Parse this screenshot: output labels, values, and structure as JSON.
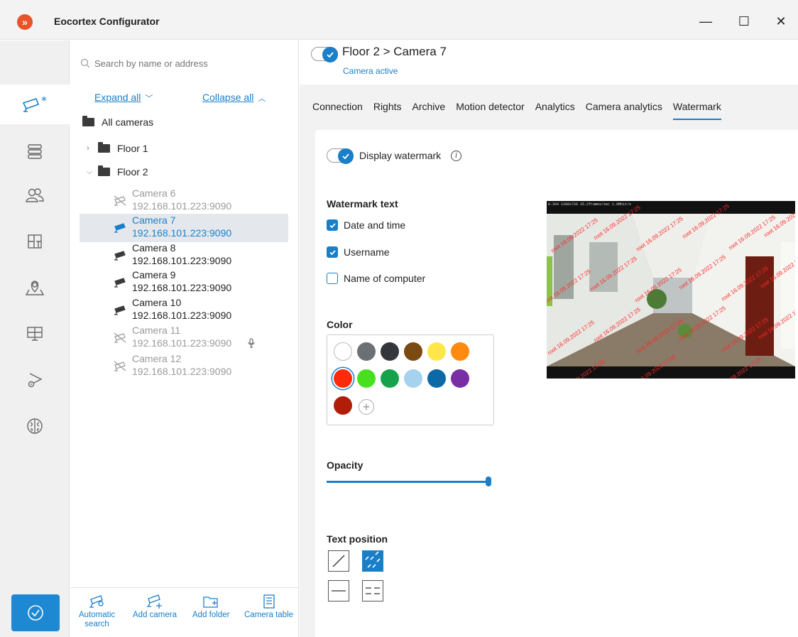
{
  "window": {
    "title": "Eocortex Configurator",
    "logo_glyph": "»",
    "min_glyph": "—",
    "max_glyph": "☐",
    "close_glyph": "✕"
  },
  "rail": {
    "items": [
      {
        "name": "cameras",
        "icon": "camera-icon",
        "active": true
      },
      {
        "name": "servers",
        "icon": "server-icon"
      },
      {
        "name": "users",
        "icon": "users-icon"
      },
      {
        "name": "layouts",
        "icon": "layout-icon"
      },
      {
        "name": "maps",
        "icon": "map-icon"
      },
      {
        "name": "workstations",
        "icon": "monitor-icon"
      },
      {
        "name": "camera-settings",
        "icon": "camera-gear-icon"
      },
      {
        "name": "neural",
        "icon": "brain-icon"
      }
    ]
  },
  "tree": {
    "search_placeholder": "Search by name or address",
    "expand_all": "Expand all",
    "collapse_all": "Collapse all",
    "root": "All cameras",
    "folders": [
      "Floor 1",
      "Floor 2"
    ],
    "cameras": [
      {
        "name": "Camera 6",
        "address": "192.168.101.223:9090",
        "state": "inactive"
      },
      {
        "name": "Camera 7",
        "address": "192.168.101.223:9090",
        "state": "selected"
      },
      {
        "name": "Camera 8",
        "address": "192.168.101.223:9090",
        "state": "active"
      },
      {
        "name": "Camera 9",
        "address": "192.168.101.223:9090",
        "state": "active"
      },
      {
        "name": "Camera 10",
        "address": "192.168.101.223:9090",
        "state": "active"
      },
      {
        "name": "Camera 11",
        "address": "192.168.101.223:9090",
        "state": "inactive"
      },
      {
        "name": "Camera 12",
        "address": "192.168.101.223:9090",
        "state": "inactive"
      }
    ],
    "tools": {
      "automatic_search_1": "Automatic",
      "automatic_search_2": "search",
      "add_camera": "Add camera",
      "add_folder": "Add folder",
      "camera_table": "Camera table"
    }
  },
  "header": {
    "title": "Floor 2 > Camera 7",
    "status": "Camera active"
  },
  "tabs": [
    "Connection",
    "Rights",
    "Archive",
    "Motion detector",
    "Analytics",
    "Camera analytics",
    "Watermark"
  ],
  "active_tab": "Watermark",
  "watermark": {
    "display_label": "Display watermark",
    "display_enabled": true,
    "text_title": "Watermark text",
    "options": [
      {
        "label": "Date and time",
        "checked": true
      },
      {
        "label": "Username",
        "checked": true
      },
      {
        "label": "Name of computer",
        "checked": false
      }
    ],
    "color_title": "Color",
    "colors": [
      "#ffffff",
      "#6b7075",
      "#33363b",
      "#7a4a12",
      "#ffe74a",
      "#ff8a0f",
      "#ff2a0a",
      "#47e01e",
      "#16a24a",
      "#a6d2ee",
      "#0b69a8",
      "#7a2ea6",
      "#b01e0a"
    ],
    "selected_color": "#ff2a0a",
    "opacity_title": "Opacity",
    "opacity": 1.0,
    "position_title": "Text position",
    "positions": [
      "diagonal-single",
      "diagonal-multiple",
      "horizontal-single",
      "horizontal-multiple"
    ],
    "selected_position": "diagonal-multiple",
    "preview_osd": "H.264 1280x720 25.2frames/sec 1.0Mbit/s",
    "preview_text": "root 16.09.2022 17:25"
  }
}
